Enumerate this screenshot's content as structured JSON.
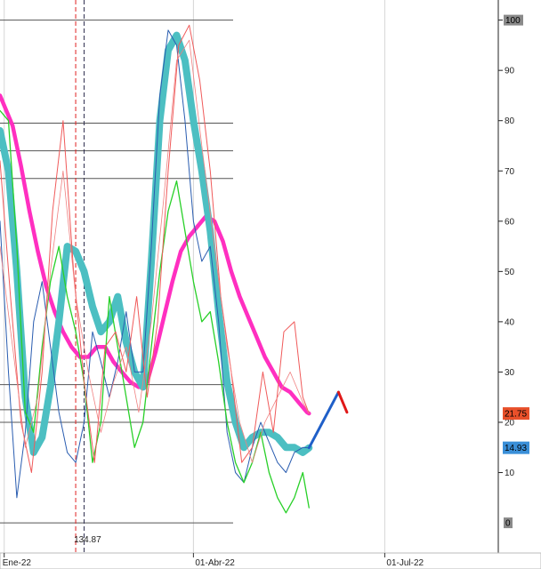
{
  "chart_data": {
    "type": "line",
    "x_ticks": [
      {
        "label": "Ene-22",
        "index": 0
      },
      {
        "label": "01-Abr-22",
        "index": 90
      },
      {
        "label": "01-Jul-22",
        "index": 181
      }
    ],
    "xlim": [
      -2,
      235
    ],
    "ylim": [
      -6,
      104
    ],
    "y_ticks": [
      10,
      20,
      30,
      40,
      50,
      60,
      70,
      80,
      90,
      100
    ],
    "y_tick_labels": [
      "10",
      "20",
      "30",
      "40",
      "50",
      "60",
      "70",
      "80",
      "90",
      "100"
    ],
    "boxed_ticks": [
      {
        "label": "100",
        "value": 100
      },
      {
        "label": "0",
        "value": 0
      }
    ],
    "reference_lines": [
      100,
      79.5,
      74,
      68.5,
      27.5,
      22.5,
      20
    ],
    "event_markers": [
      {
        "index": 34,
        "color": "#e02020"
      },
      {
        "index": 38,
        "color": "#303050"
      }
    ],
    "event_label": "134.87",
    "value_tags": [
      {
        "label": "21.75",
        "value": 21.75,
        "bg": "#e8502a"
      },
      {
        "label": "14.93",
        "value": 14.93,
        "bg": "#3a8fd8"
      }
    ],
    "series": [
      {
        "color": "#ff2fc0",
        "width": 4.5,
        "x": [
          -2,
          4,
          8,
          12,
          16,
          20,
          24,
          28,
          32,
          36,
          40,
          44,
          48,
          52,
          56,
          60,
          64,
          68,
          72,
          76,
          80,
          84,
          88,
          92,
          96,
          100,
          104,
          108,
          112,
          116,
          120,
          124,
          128,
          132,
          136,
          140,
          144,
          145
        ],
        "y": [
          85,
          79,
          71,
          62,
          54,
          47,
          42,
          38,
          35,
          33,
          33,
          35,
          35,
          32,
          30,
          28,
          27,
          28,
          34,
          41,
          48,
          54,
          57,
          59,
          61,
          60,
          56,
          50,
          45,
          41,
          37,
          33,
          30,
          27,
          26,
          24,
          22,
          21.75
        ]
      },
      {
        "color": "#4cbfc2",
        "width": 8,
        "x": [
          -2,
          2,
          6,
          10,
          14,
          18,
          22,
          26,
          30,
          34,
          38,
          42,
          46,
          50,
          54,
          58,
          62,
          66,
          70,
          74,
          78,
          82,
          86,
          90,
          94,
          98,
          102,
          106,
          110,
          114,
          118,
          122,
          126,
          130,
          134,
          138,
          142,
          145
        ],
        "y": [
          78,
          70,
          50,
          25,
          14,
          17,
          27,
          40,
          55,
          54,
          50,
          43,
          38,
          40,
          45,
          36,
          30,
          27,
          52,
          80,
          94,
          97,
          92,
          80,
          70,
          58,
          42,
          28,
          20,
          15,
          17,
          18,
          18,
          17,
          15,
          15,
          14,
          14.93
        ]
      },
      {
        "color": "#2a5db0",
        "width": 1,
        "x": [
          -2,
          2,
          6,
          10,
          14,
          18,
          22,
          26,
          30,
          34,
          38,
          42,
          46,
          50,
          54,
          58,
          62,
          66,
          70,
          74,
          78,
          82,
          86,
          90,
          94,
          98,
          102,
          106,
          110,
          114,
          118,
          122,
          126,
          130,
          134,
          138,
          142,
          145
        ],
        "y": [
          60,
          30,
          5,
          18,
          40,
          48,
          35,
          22,
          14,
          12,
          20,
          38,
          32,
          25,
          32,
          42,
          30,
          30,
          55,
          85,
          98,
          95,
          80,
          60,
          52,
          55,
          40,
          18,
          10,
          8,
          15,
          20,
          16,
          12,
          10,
          14,
          15,
          14.93
        ]
      },
      {
        "color": "#28d028",
        "width": 1.3,
        "x": [
          -2,
          2,
          6,
          10,
          14,
          18,
          22,
          26,
          30,
          34,
          38,
          42,
          46,
          50,
          54,
          58,
          62,
          66,
          70,
          74,
          78,
          82,
          86,
          90,
          94,
          98,
          102,
          106,
          110,
          114,
          118,
          122,
          126,
          130,
          134,
          138,
          142,
          145
        ],
        "y": [
          82,
          80,
          55,
          22,
          18,
          35,
          48,
          55,
          45,
          38,
          28,
          12,
          20,
          45,
          35,
          25,
          15,
          20,
          35,
          50,
          62,
          68,
          58,
          48,
          40,
          42,
          32,
          20,
          12,
          8,
          12,
          18,
          10,
          5,
          2,
          5,
          10,
          3
        ]
      },
      {
        "color": "#f05a5a",
        "width": 1,
        "x": [
          -2,
          3,
          8,
          13,
          18,
          23,
          28,
          33,
          38,
          43,
          48,
          53,
          58,
          63,
          68,
          73,
          78,
          83,
          88,
          93,
          98,
          103,
          108,
          113,
          118,
          123,
          128,
          133,
          138,
          142,
          145
        ],
        "y": [
          72,
          45,
          20,
          10,
          30,
          62,
          80,
          50,
          28,
          12,
          35,
          38,
          30,
          45,
          25,
          40,
          70,
          95,
          99,
          88,
          70,
          45,
          30,
          12,
          15,
          30,
          18,
          38,
          40,
          25,
          21.75
        ]
      },
      {
        "color": "#f08080",
        "width": 0.8,
        "x": [
          -2,
          4,
          10,
          16,
          22,
          28,
          34,
          40,
          46,
          52,
          58,
          64,
          70,
          76,
          82,
          88,
          94,
          100,
          106,
          112,
          118,
          124,
          130,
          136,
          142,
          145
        ],
        "y": [
          55,
          35,
          15,
          25,
          50,
          70,
          45,
          30,
          18,
          28,
          35,
          22,
          40,
          65,
          92,
          96,
          75,
          55,
          35,
          20,
          12,
          20,
          25,
          30,
          24,
          21.75
        ]
      },
      {
        "color": "#1f5fc8",
        "width": 3,
        "x": [
          145,
          159
        ],
        "y": [
          14.93,
          26
        ]
      },
      {
        "color": "#e01818",
        "width": 3,
        "x": [
          159,
          163
        ],
        "y": [
          26,
          22
        ]
      }
    ]
  }
}
